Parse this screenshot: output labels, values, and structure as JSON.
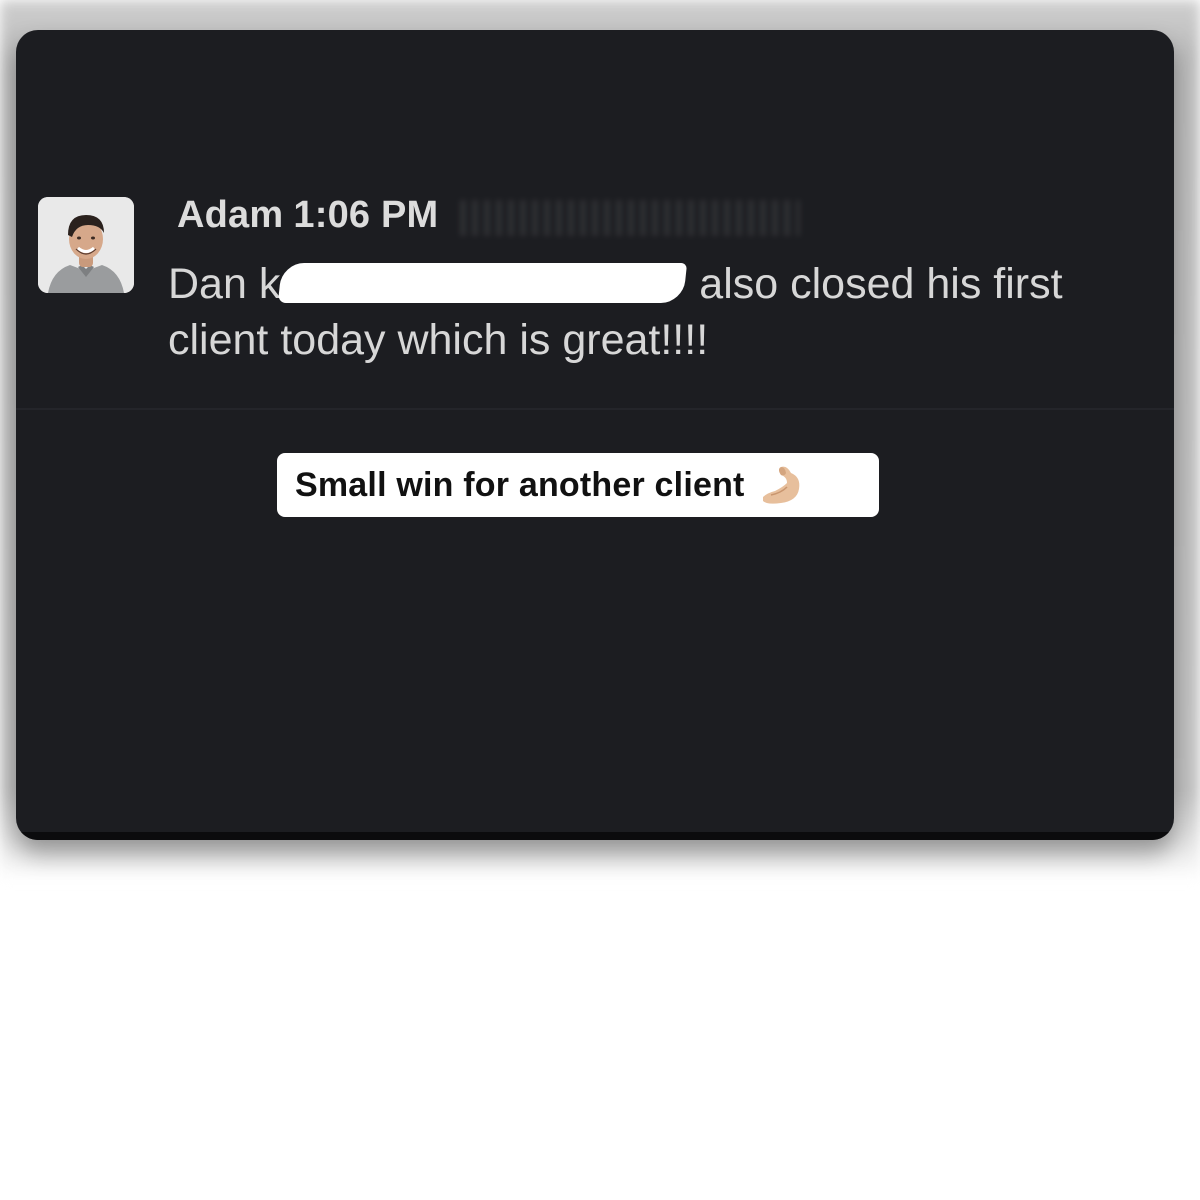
{
  "message": {
    "author": "Adam",
    "time": "1:06 PM",
    "text_line1_start": "Dan ",
    "text_line1_fragment": "k",
    "text_line1_end": " also closed his first",
    "text_line2": "client today which is great!!!!"
  },
  "caption": {
    "label": "Small win for another client",
    "emoji_icon": "flexed-biceps-icon"
  },
  "colors": {
    "card_background": "#1c1d21",
    "text": "#d7d7d7",
    "caption_background": "#ffffff"
  }
}
